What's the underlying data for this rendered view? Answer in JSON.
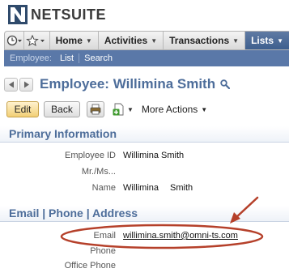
{
  "app": {
    "brand": "NETSUITE",
    "brand_color": "#3a3a3a",
    "accent_color": "#4d6d9a"
  },
  "nav": {
    "icons": [
      "recent-records-icon",
      "favorites-icon"
    ],
    "items": [
      {
        "label": "Home",
        "active": false
      },
      {
        "label": "Activities",
        "active": false
      },
      {
        "label": "Transactions",
        "active": false
      },
      {
        "label": "Lists",
        "active": true
      }
    ]
  },
  "subnav": {
    "context_label": "Employee:",
    "links": [
      "List",
      "Search"
    ]
  },
  "record": {
    "title": "Employee: Willimina Smith"
  },
  "actions": {
    "edit": "Edit",
    "back": "Back",
    "more_actions": "More Actions"
  },
  "sections": {
    "primary": {
      "title": "Primary Information",
      "fields": {
        "employee_id": {
          "label": "Employee ID",
          "value": "Willimina Smith"
        },
        "salutation": {
          "label": "Mr./Ms...",
          "value": ""
        },
        "name": {
          "label": "Name",
          "first": "Willimina",
          "last": "Smith"
        }
      }
    },
    "contact": {
      "title": "Email | Phone | Address",
      "fields": {
        "email": {
          "label": "Email",
          "value": "willimina.smith@omni-ts.com"
        },
        "phone": {
          "label": "Phone",
          "value": ""
        },
        "office_phone": {
          "label": "Office Phone",
          "value": ""
        }
      }
    }
  },
  "annotation": {
    "color": "#b5402a"
  }
}
